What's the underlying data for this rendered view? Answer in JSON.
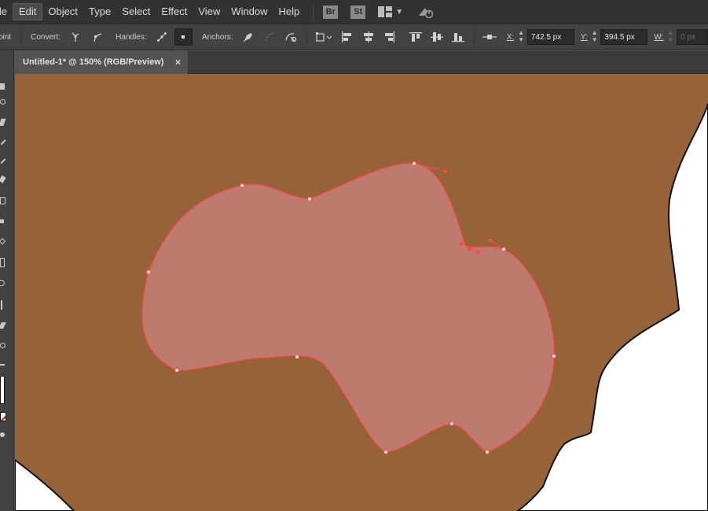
{
  "menubar": {
    "items": [
      "ile",
      "Edit",
      "Object",
      "Type",
      "Select",
      "Effect",
      "View",
      "Window",
      "Help"
    ],
    "active_index": 1,
    "bridge_badge": "Br",
    "stock_badge": "St"
  },
  "controlbar": {
    "point_label": "oint",
    "convert_label": "Convert:",
    "handles_label": "Handles:",
    "anchors_label": "Anchors:",
    "x_label": "X:",
    "x_value": "742.5 px",
    "y_label": "Y:",
    "y_value": "394.5 px",
    "w_label": "W:",
    "w_value": "0 px"
  },
  "document": {
    "tab_title": "Untitled-1* @ 150% (RGB/Preview)",
    "close_symbol": "×"
  },
  "canvas": {
    "background_color": "#96623a",
    "shape_fill": "#bd7b6f",
    "path_color": "#ff4a4a"
  }
}
